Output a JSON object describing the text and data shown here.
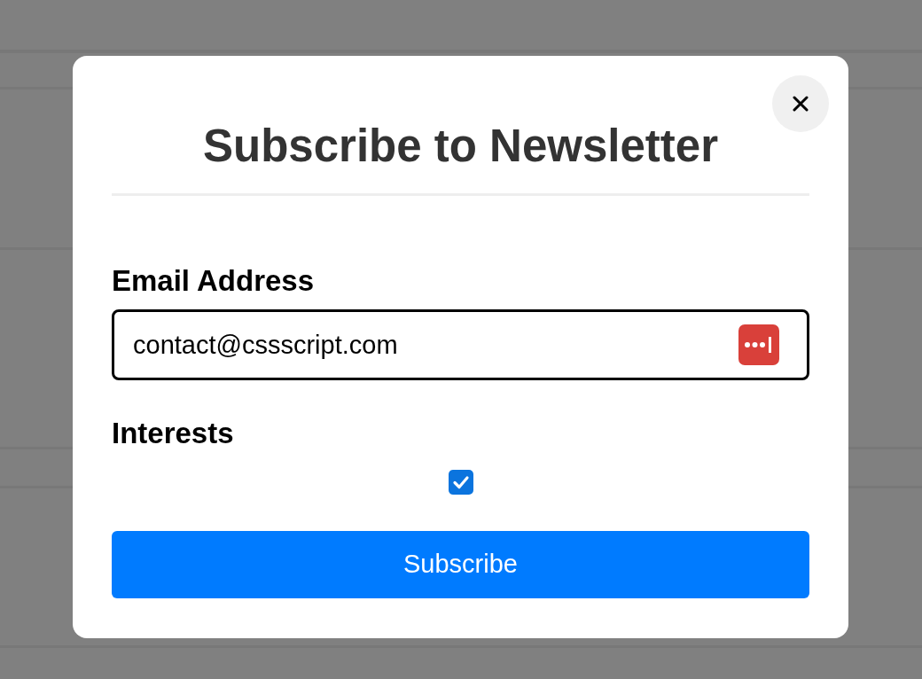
{
  "modal": {
    "title": "Subscribe to Newsletter",
    "fields": [
      {
        "kind": "email",
        "label": "Email Address",
        "value": "contact@cssscript.com"
      },
      {
        "kind": "checkbox",
        "label": "Interests",
        "checked": true
      }
    ],
    "submit": "Subscribe"
  }
}
